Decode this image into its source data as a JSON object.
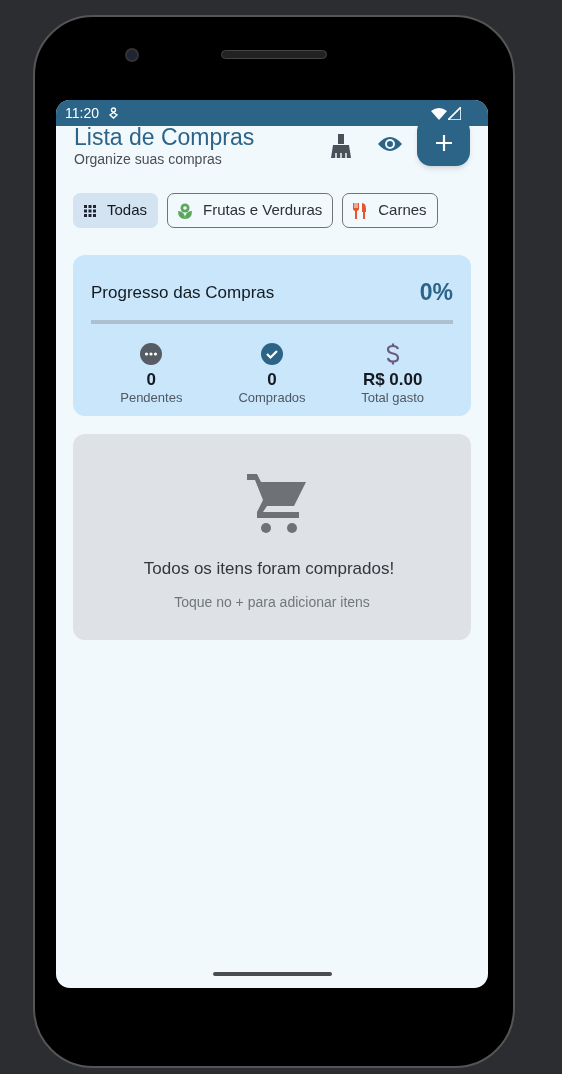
{
  "status_bar": {
    "time": "11:20"
  },
  "header": {
    "title": "Lista de Compras",
    "subtitle": "Organize suas compras"
  },
  "filters": [
    {
      "label": "Todas",
      "kind": "grid",
      "selected": true
    },
    {
      "label": "Frutas e Verduras",
      "kind": "produce",
      "selected": false
    },
    {
      "label": "Carnes",
      "kind": "meat",
      "selected": false
    }
  ],
  "progress": {
    "title": "Progresso das Compras",
    "percent": "0%",
    "level": 0,
    "stats": [
      {
        "kind": "pending",
        "value": "0",
        "label": "Pendentes"
      },
      {
        "kind": "bought",
        "value": "0",
        "label": "Comprados"
      },
      {
        "kind": "spent",
        "value": "R$ 0.00",
        "label": "Total gasto"
      }
    ]
  },
  "empty_state": {
    "title": "Todos os itens foram comprados!",
    "hint": "Toque no + para adicionar itens"
  }
}
